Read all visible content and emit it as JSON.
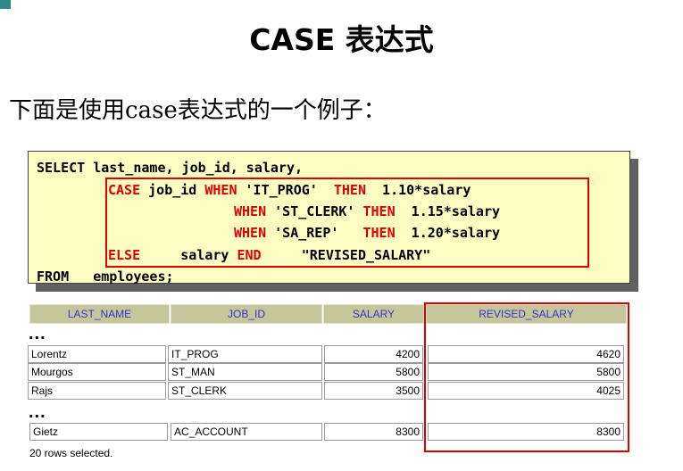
{
  "slide": {
    "title": "CASE 表达式",
    "subtitle": "下面是使用case表达式的一个例子：",
    "accent_color": "#2d8a8a",
    "highlight_color": "#e00000"
  },
  "code": {
    "line1": "SELECT last_name, job_id, salary,",
    "case_kw": "CASE",
    "case_expr": " job_id ",
    "when_kw": "WHEN",
    "then_kw": "THEN",
    "when1_val": " 'IT_PROG'  ",
    "then1_val": "  1.10*salary",
    "when2_val": " 'ST_CLERK' ",
    "then2_val": "  1.15*salary",
    "when3_val": " 'SA_REP'   ",
    "then3_val": "  1.20*salary",
    "else_kw": "ELSE",
    "else_val": "     salary ",
    "end_kw": "END",
    "alias": "     \"REVISED_SALARY\"",
    "from_line": "FROM   employees;"
  },
  "table": {
    "headers": [
      "LAST_NAME",
      "JOB_ID",
      "SALARY",
      "REVISED_SALARY"
    ],
    "ellipsis": "...",
    "rows": [
      [
        "Lorentz",
        "IT_PROG",
        "4200",
        "4620"
      ],
      [
        "Mourgos",
        "ST_MAN",
        "5800",
        "5800"
      ],
      [
        "Rajs",
        "ST_CLERK",
        "3500",
        "4025"
      ]
    ],
    "last_row": [
      "Gietz",
      "AC_ACCOUNT",
      "8300",
      "8300"
    ],
    "footer": "20 rows selected."
  }
}
